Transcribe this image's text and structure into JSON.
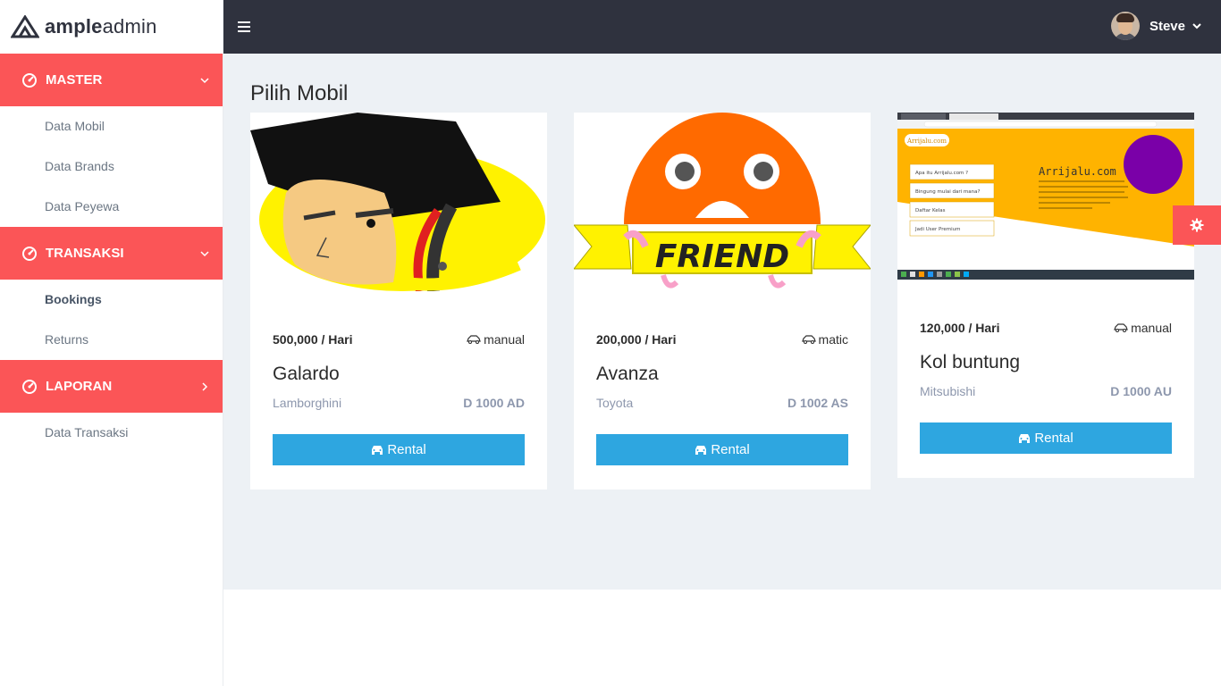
{
  "brand": {
    "bold": "ample",
    "light": "admin"
  },
  "sidebar": {
    "sections": [
      {
        "label": "MASTER",
        "items": [
          "Data Mobil",
          "Data Brands",
          "Data Peyewa"
        ]
      },
      {
        "label": "TRANSAKSI",
        "items": [
          "Bookings",
          "Returns"
        ]
      },
      {
        "label": "LAPORAN",
        "items": [
          "Data Transaksi"
        ]
      }
    ]
  },
  "topbar": {
    "username": "Steve"
  },
  "main": {
    "title": "Pilih Mobil",
    "cars": [
      {
        "price": "500,000 / Hari",
        "transmission": "manual",
        "name": "Galardo",
        "brand": "Lamborghini",
        "plate": "D 1000 AD",
        "button": "Rental"
      },
      {
        "price": "200,000 / Hari",
        "transmission": "matic",
        "name": "Avanza",
        "brand": "Toyota",
        "plate": "D 1002 AS",
        "button": "Rental"
      },
      {
        "price": "120,000 / Hari",
        "transmission": "manual",
        "name": "Kol buntung",
        "brand": "Mitsubishi",
        "plate": "D 1000 AU",
        "button": "Rental"
      }
    ],
    "image_texts": {
      "friend_banner": "FRIEND",
      "arrijalu_logo": "Arrijalu.com",
      "arrijalu_heading": "Arrijalu.com",
      "arrijalu_menu": [
        "Apa itu Arrijalu.com ?",
        "Bingung mulai dari mana?",
        "Daftar Kelas",
        "Jadi User Premium"
      ]
    }
  },
  "colors": {
    "accent": "#fb5557",
    "topbar": "#2f323e",
    "button": "#2ea6e0",
    "background": "#edf1f5"
  },
  "icons": {
    "menu": "hamburger-icon",
    "section": "dashboard-icon",
    "settings": "gear-icon",
    "car": "car-icon"
  }
}
